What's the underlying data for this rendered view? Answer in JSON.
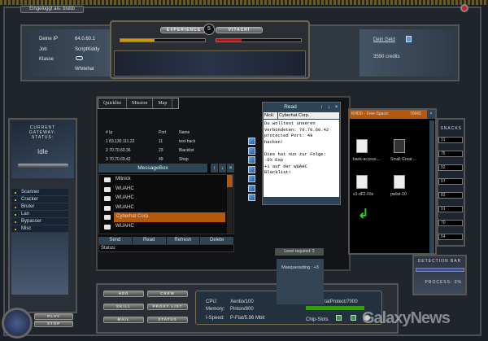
{
  "login": {
    "text": "Eingeloggt als: blubb"
  },
  "header": {
    "ip_label": "Deine IP",
    "ip": "64.0.60.1",
    "job_label": "Job",
    "job": "ScriptKiddy",
    "class_label": "Klasse",
    "class": "Whitehat",
    "experience_label": "EXPERIENCE",
    "vitachi_label": "VITACHI",
    "level": "5",
    "experience_pct": 40,
    "vitachi_pct": 30,
    "money_link": "Dein Geld",
    "credits": "3590 credits"
  },
  "sidebar": {
    "status_title": "CURRENT GATEWAY-STATUS:",
    "status": "Idle",
    "tools": [
      "Scanner",
      "Cracker",
      "Bruter",
      "Lan",
      "Bypasser",
      "Misc"
    ],
    "play": "PLAY",
    "stop": "STOP"
  },
  "quicklist": {
    "tabs": [
      "Quicklist",
      "Mission",
      "Map"
    ],
    "headers": [
      "# Ip",
      "Port",
      "Name"
    ],
    "rows": [
      {
        "ip": "1 83.130.111.22",
        "port": "11",
        "name": "test-hack"
      },
      {
        "ip": "2 70.70.60.36",
        "port": "23",
        "name": "Blacklist"
      },
      {
        "ip": "3 70.70.60.42",
        "port": "49",
        "name": "Shop"
      }
    ]
  },
  "messagebox": {
    "title": "MessageBox",
    "items": [
      "Mitnick",
      "WUAHC",
      "WUAHC",
      "WUAHC",
      "Cyberhat Corp.",
      "WUAHC"
    ],
    "selected": 4,
    "buttons": [
      "Send",
      "Read",
      "Refresh",
      "Delete"
    ],
    "status": "Status:"
  },
  "read": {
    "title": "Read",
    "nick_label": "Nick:",
    "nick": "Cyberhat Corp.",
    "body": "Du wolltest unseren\nVerbündeten: 70.70.60.42\nprotected Port: 49\nhacken!\n\nDies hat nun zur Folge:\n-5% Exp\n+1 auf der WUAHC\nBlacklist!"
  },
  "khdd": {
    "title": "KHDD - Free-Space:",
    "space": "70665",
    "files": [
      "bank-access-...",
      "Small Great ...",
      "s3-dF2-File",
      "pwlist-10"
    ]
  },
  "snacks": {
    "title": "SNACKS",
    "values": [
      "31",
      "75",
      "92",
      "97",
      "82",
      "91",
      "70",
      "64"
    ]
  },
  "detection": {
    "title": "DETECTION BAR",
    "process": "PROCESS: 0%",
    "level_pct": 100
  },
  "bottom": {
    "buttons": [
      "HDD",
      "CREW",
      "SKILL",
      "PROXY LIST",
      "MAIL",
      "STATUS"
    ],
    "cpu_label": "CPU:",
    "cpu": "Xentio/100",
    "mem_label": "Memory:",
    "mem": "Pinton/800",
    "speed_label": "I-Speed:",
    "speed": "P-Flat/5.96 Mbit",
    "protect": "tatProtect/7000",
    "chip_label": "Chip-Slots"
  },
  "tooltip": {
    "level": "Level required: 2",
    "effect": "Masquerading : +3"
  },
  "watermark": "GalaxyNews",
  "colors": {
    "accent": "#b4580d",
    "exp": "#c89a10",
    "vitachi": "#b01818",
    "panel": "#2d4456"
  }
}
